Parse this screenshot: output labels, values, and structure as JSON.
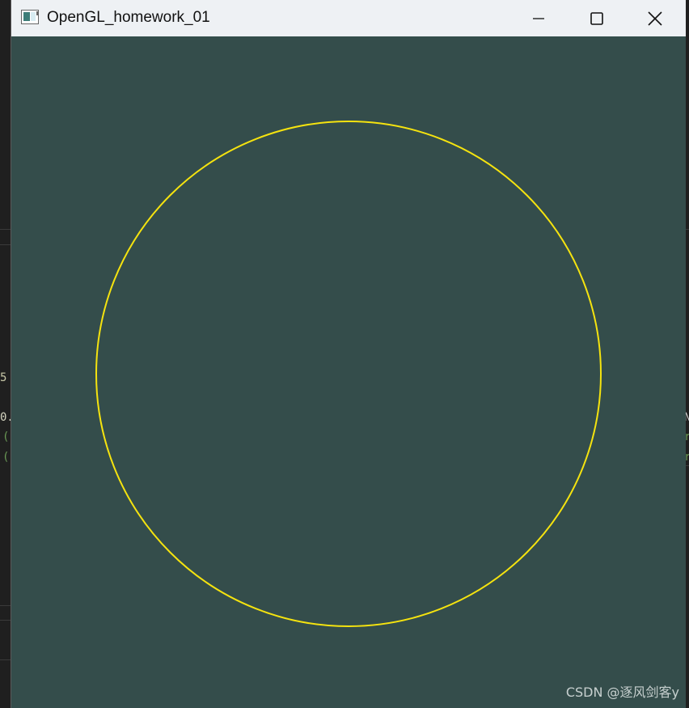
{
  "window": {
    "title": "OpenGL_homework_01",
    "app_icon": "window-app-icon",
    "controls": {
      "minimize_icon": "minimize-icon",
      "maximize_icon": "maximize-icon",
      "close_icon": "close-icon"
    }
  },
  "viewport": {
    "clear_color": "#344d4b",
    "shape": "circle",
    "stroke_color": "#f5e30f"
  },
  "background_fragments": {
    "left_1": "5",
    "left_2": "0.",
    "left_3": "(",
    "left_4": "(",
    "right_1": "N",
    "right_2": "r",
    "right_3": "r"
  },
  "watermark": "CSDN @逐风剑客y"
}
